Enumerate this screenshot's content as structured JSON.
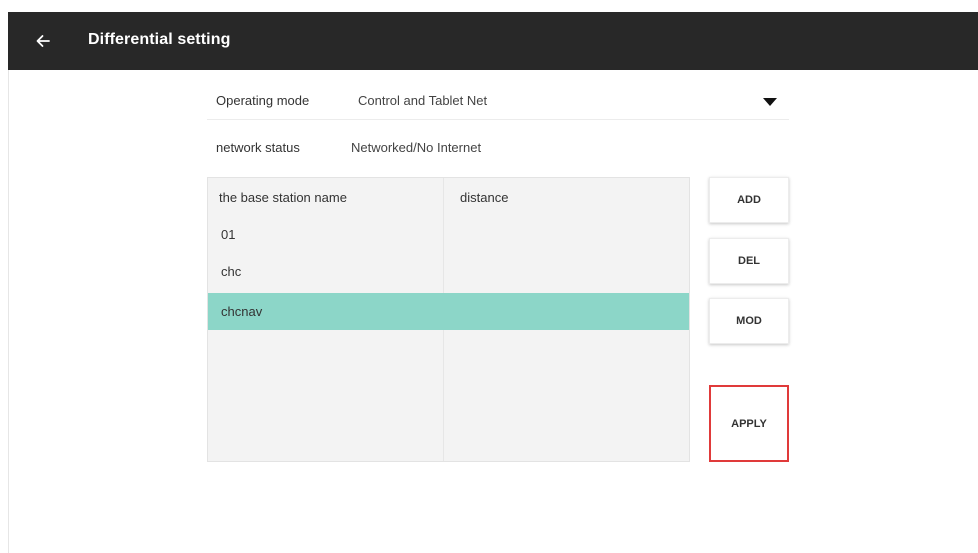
{
  "app_bar": {
    "title": "Differential setting",
    "back_icon": "arrow-left-icon",
    "background": "#282828"
  },
  "form": {
    "operating_mode": {
      "label": "Operating mode",
      "value": "Control and Tablet Net",
      "dropdown_icon": "caret-down-icon"
    },
    "network_status": {
      "label": "network status",
      "value": "Networked/No Internet"
    }
  },
  "table": {
    "columns": [
      "the base station name",
      "distance"
    ],
    "rows": [
      {
        "name": "01",
        "distance": "",
        "selected": false
      },
      {
        "name": "chc",
        "distance": "",
        "selected": false
      },
      {
        "name": "chcnav",
        "distance": "",
        "selected": true
      }
    ],
    "selected_color": "#8cd6c8"
  },
  "buttons": {
    "add": "ADD",
    "del": "DEL",
    "mod": "MOD",
    "apply": "APPLY",
    "apply_highlight_color": "#e03a3a"
  }
}
